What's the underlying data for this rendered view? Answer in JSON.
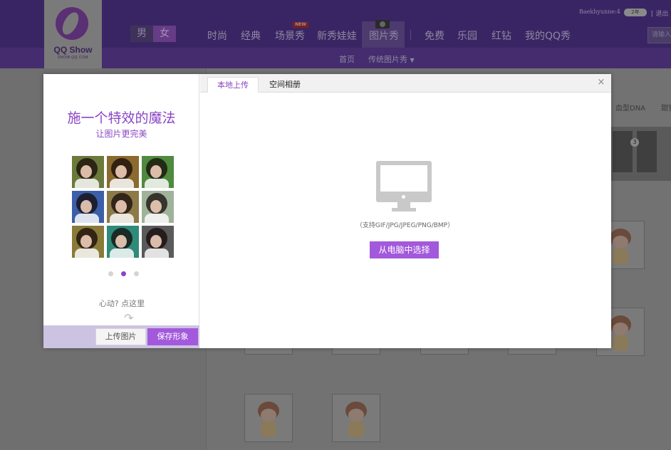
{
  "header": {
    "logo_brand": "QQ Show",
    "logo_url": "SHOW.QQ.COM",
    "gender": {
      "male": "男",
      "female": "女"
    },
    "nav": [
      "时尚",
      "经典",
      "场景秀",
      "新秀娃娃",
      "图片秀",
      "免费",
      "乐园",
      "红钻",
      "我的QQ秀"
    ],
    "new_badge": "NEW",
    "user_name": "Baekhyunne:4",
    "vip_label": "2年",
    "logout": "[ 退出",
    "search_placeholder": "请输入"
  },
  "subnav": {
    "home": "首页",
    "current": "传统图片秀"
  },
  "background": {
    "filter_tabs": [
      "血型DNA",
      "甜蜜"
    ],
    "photo_strip_number": "3"
  },
  "modal": {
    "promo_title": "施一个特效的魔法",
    "promo_subtitle": "让图片更完美",
    "effects": [
      {
        "name": "original",
        "bg": "#6b7a3a"
      },
      {
        "name": "warm",
        "bg": "#8a6a2e"
      },
      {
        "name": "green",
        "bg": "#4f8a3e"
      },
      {
        "name": "blue",
        "bg": "#3b5fa8"
      },
      {
        "name": "sepia",
        "bg": "#8c7a48"
      },
      {
        "name": "pastel",
        "bg": "#9fb39a"
      },
      {
        "name": "vintage",
        "bg": "#8a7a3a"
      },
      {
        "name": "teal",
        "bg": "#2f8a7a"
      },
      {
        "name": "bw",
        "bg": "#5a5a5a"
      }
    ],
    "carousel_active": 1,
    "tease_text": "心动? 点这里",
    "upload_button": "上传图片",
    "save_button": "保存形象",
    "tabs": [
      "本地上传",
      "空间相册"
    ],
    "close_symbol": "×",
    "formats_text": "（支持GIF/JPG/JPEG/PNG/BMP）",
    "choose_button": "从电脑中选择"
  },
  "colors": {
    "accent": "#a259db",
    "accent_text": "#8a45c4",
    "header_bg": "#3a2564",
    "overlay_bg": "#6f6f6f"
  }
}
